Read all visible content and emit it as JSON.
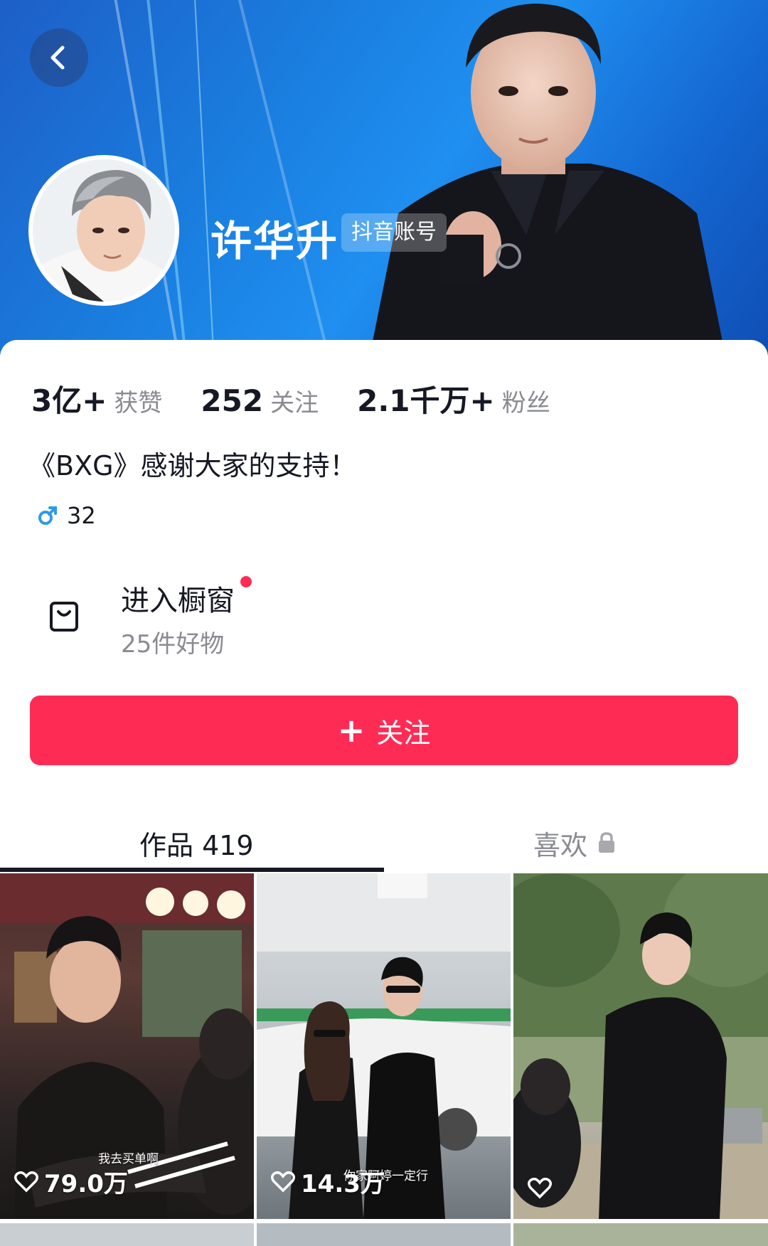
{
  "profile": {
    "name": "许华升",
    "account_badge": "抖音账号"
  },
  "stats": [
    {
      "value": "3亿+",
      "label": "获赞"
    },
    {
      "value": "252",
      "label": "关注"
    },
    {
      "value": "2.1千万+",
      "label": "粉丝"
    }
  ],
  "bio": "《BXG》感谢大家的支持！",
  "gender": {
    "symbol": "♂",
    "age": "32"
  },
  "shop": {
    "title": "进入橱窗",
    "subtitle": "25件好物"
  },
  "follow": {
    "plus": "+",
    "label": "关注"
  },
  "tabs": {
    "works": {
      "label": "作品 419"
    },
    "likes": {
      "label": "喜欢"
    }
  },
  "videos": [
    {
      "likes": "79.0万",
      "caption": "我去买单啊"
    },
    {
      "likes": "14.3万",
      "caption": "你家阿婷一定行"
    },
    {
      "likes": "",
      "caption": ""
    }
  ],
  "colors": {
    "accent": "#fe2c55",
    "banner": "#1a7fe0",
    "gender": "#2d9ae8"
  },
  "icons": [
    "back-arrow-icon",
    "shopping-bag-icon",
    "lock-icon",
    "heart-icon",
    "male-icon",
    "plus-icon"
  ]
}
